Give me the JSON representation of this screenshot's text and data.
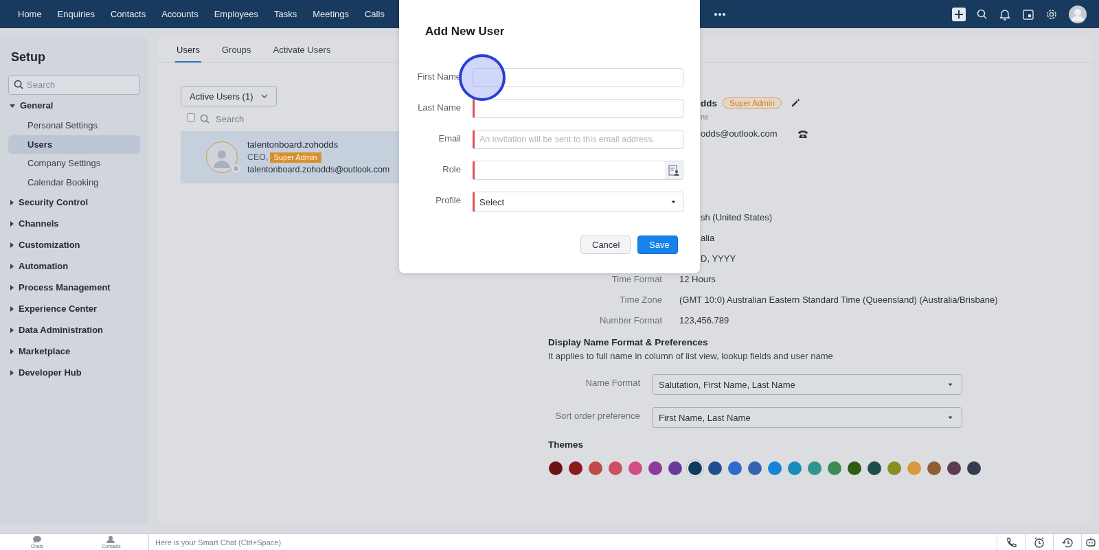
{
  "top_nav": {
    "items": [
      {
        "label": "Home"
      },
      {
        "label": "Enquiries"
      },
      {
        "label": "Contacts"
      },
      {
        "label": "Accounts"
      },
      {
        "label": "Employees"
      },
      {
        "label": "Tasks"
      },
      {
        "label": "Meetings"
      },
      {
        "label": "Calls"
      }
    ]
  },
  "sidebar": {
    "title": "Setup",
    "search_placeholder": "Search",
    "sections": [
      {
        "label": "General",
        "expanded": true,
        "children": [
          {
            "label": "Personal Settings",
            "selected": false
          },
          {
            "label": "Users",
            "selected": true
          },
          {
            "label": "Company Settings",
            "selected": false
          },
          {
            "label": "Calendar Booking",
            "selected": false
          }
        ]
      },
      {
        "label": "Security Control",
        "expanded": false
      },
      {
        "label": "Channels",
        "expanded": false
      },
      {
        "label": "Customization",
        "expanded": false
      },
      {
        "label": "Automation",
        "expanded": false
      },
      {
        "label": "Process Management",
        "expanded": false
      },
      {
        "label": "Experience Center",
        "expanded": false
      },
      {
        "label": "Data Administration",
        "expanded": false
      },
      {
        "label": "Marketplace",
        "expanded": false
      },
      {
        "label": "Developer Hub",
        "expanded": false
      }
    ]
  },
  "tabs": [
    {
      "label": "Users",
      "selected": true
    },
    {
      "label": "Groups",
      "selected": false
    },
    {
      "label": "Activate Users",
      "selected": false
    }
  ],
  "user_list": {
    "filter": "Active Users (1)",
    "search_placeholder": "Search",
    "select_all_checked": false,
    "users": [
      {
        "name": "talentonboard.zohodds",
        "role": "CEO,",
        "badge": "Super Admin",
        "email": "talentonboard.zohodds@outlook.com",
        "selected": true
      }
    ]
  },
  "user_detail": {
    "name": "dds",
    "badge": "Super Admin",
    "subtitle": "ns",
    "email": "odds@outlook.com",
    "fields": [
      {
        "value": "sh (United States)"
      },
      {
        "value": "alia"
      },
      {
        "value": "D, YYYY"
      },
      {
        "label": "Time Format",
        "value": "12 Hours"
      },
      {
        "label": "Time Zone",
        "value": "(GMT 10:0) Australian Eastern Standard Time (Queensland) (Australia/Brisbane)"
      },
      {
        "label": "Number Format",
        "value": "123,456.789"
      }
    ]
  },
  "display_name": {
    "heading": "Display Name Format & Preferences",
    "description": "It applies to full name in column of list view, lookup fields and user name",
    "settings": [
      {
        "label": "Name Format",
        "value": "Salutation, First Name, Last Name"
      },
      {
        "label": "Sort order preference",
        "value": "First Name, Last Name"
      }
    ]
  },
  "themes": {
    "heading": "Themes",
    "swatches": [
      {
        "color": "#6b1416",
        "selected": false
      },
      {
        "color": "#8b1a1a",
        "selected": false
      },
      {
        "color": "#c04848",
        "selected": false
      },
      {
        "color": "#cc5060",
        "selected": false
      },
      {
        "color": "#d24d85",
        "selected": false
      },
      {
        "color": "#8e3a9a",
        "selected": false
      },
      {
        "color": "#6a3a9a",
        "selected": false
      },
      {
        "color": "#0f3a60",
        "selected": true
      },
      {
        "color": "#1f4e8e",
        "selected": false
      },
      {
        "color": "#2f6acc",
        "selected": false
      },
      {
        "color": "#3a62b2",
        "selected": false
      },
      {
        "color": "#1584d6",
        "selected": false
      },
      {
        "color": "#1a8cbc",
        "selected": false
      },
      {
        "color": "#2e9590",
        "selected": false
      },
      {
        "color": "#3f8b55",
        "selected": false
      },
      {
        "color": "#2e5d16",
        "selected": false
      },
      {
        "color": "#1d4e4c",
        "selected": false
      },
      {
        "color": "#8a8d20",
        "selected": false
      },
      {
        "color": "#d6993d",
        "selected": false
      },
      {
        "color": "#8d5d36",
        "selected": false
      },
      {
        "color": "#5a3d50",
        "selected": false
      },
      {
        "color": "#363c50",
        "selected": false
      }
    ]
  },
  "dialog": {
    "title": "Add New User",
    "fields": [
      {
        "label": "First Name",
        "kind": "text",
        "required": false,
        "highlighted": true
      },
      {
        "label": "Last Name",
        "kind": "text",
        "required": true
      },
      {
        "label": "Email",
        "kind": "text",
        "required": true,
        "placeholder": "An invitation will be sent to this email address."
      },
      {
        "label": "Role",
        "kind": "lookup",
        "required": true
      },
      {
        "label": "Profile",
        "kind": "select",
        "required": true,
        "value": "Select"
      }
    ],
    "buttons": [
      {
        "label": "Cancel",
        "kind": "secondary"
      },
      {
        "label": "Save",
        "kind": "primary"
      }
    ]
  },
  "bottom_bar": {
    "apps": [
      {
        "label": "Chats"
      },
      {
        "label": "Contacts"
      }
    ],
    "chat_placeholder": "Here is your Smart Chat (Ctrl+Space)"
  }
}
